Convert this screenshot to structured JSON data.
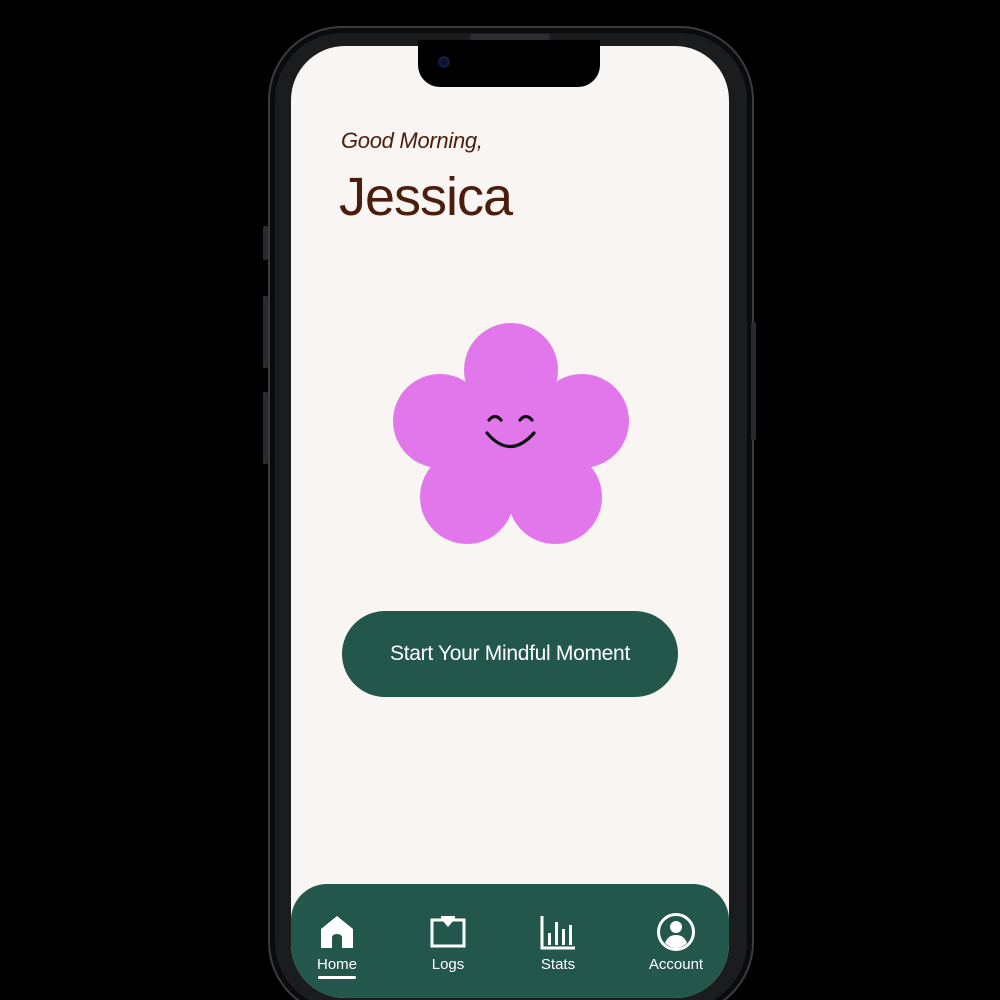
{
  "header": {
    "greeting": "Good Morning,",
    "user_name": "Jessica"
  },
  "mascot": {
    "icon": "smiling-flower-icon",
    "petal_color": "#e277eb",
    "face_color": "#111111"
  },
  "cta": {
    "label": "Start Your Mindful Moment",
    "color": "#23574c"
  },
  "bottom_nav": {
    "active": "Home",
    "items": [
      {
        "label": "Home",
        "icon": "home-icon"
      },
      {
        "label": "Logs",
        "icon": "logs-icon"
      },
      {
        "label": "Stats",
        "icon": "stats-icon"
      },
      {
        "label": "Account",
        "icon": "account-icon"
      }
    ]
  },
  "colors": {
    "screen_background": "#f9f5f2",
    "text_brown": "#4a1d0c",
    "brand_green": "#23574c"
  }
}
